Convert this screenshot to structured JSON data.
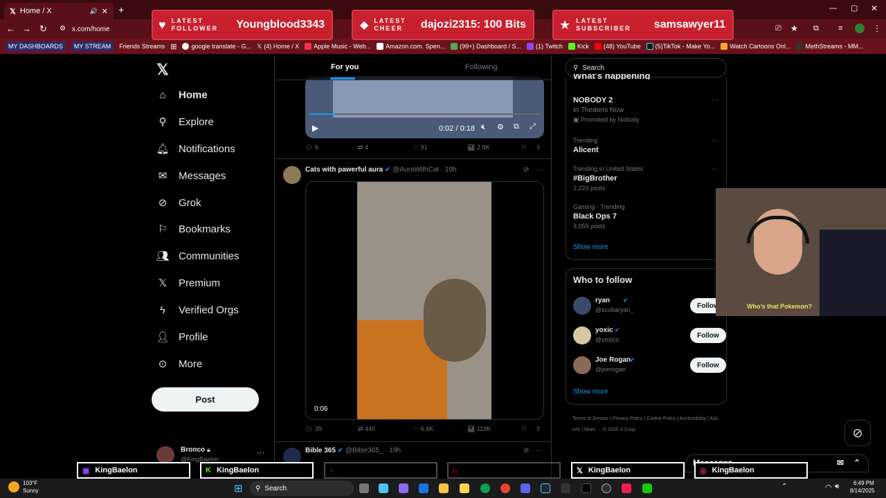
{
  "browser": {
    "tab_title": "Home / X",
    "url": "x.com/home",
    "bookmarks": [
      "MY DASHBOARDS",
      "MY STREAM",
      "Friends Streams",
      "google translate - G...",
      "(4) Home / X",
      "Apple Music - Web...",
      "Amazon.com. Spen...",
      "(99+) Dashboard / S...",
      "(1) Twitch",
      "Kick",
      "(48) YouTube",
      "(5)TikTok - Make Yo...",
      "Watch Cartoons Onl...",
      "MethStreams - MM..."
    ]
  },
  "overlay": {
    "follower_label_1": "LATEST",
    "follower_label_2": "FOLLOWER",
    "follower_value": "Youngblood3343",
    "cheer_label_1": "LATEST",
    "cheer_label_2": "CHEER",
    "cheer_value": "dajozi2315: 100 Bits",
    "sub_label_1": "LATEST",
    "sub_label_2": "SUBSCRIBER",
    "sub_value": "samsawyer11",
    "webcam_caption": "Who's that Pokemon?"
  },
  "nav": {
    "items": [
      "Home",
      "Explore",
      "Notifications",
      "Messages",
      "Grok",
      "Bookmarks",
      "Communities",
      "Premium",
      "Verified Orgs",
      "Profile",
      "More"
    ],
    "post_label": "Post",
    "account_name": "Bronco",
    "account_handle": "@KingBaelon"
  },
  "feed": {
    "tab_for_you": "For you",
    "tab_following": "Following",
    "video1": {
      "time": "0:02 / 0:18",
      "replies": "6",
      "reposts": "4",
      "likes": "91",
      "views": "2.8K"
    },
    "post2": {
      "name": "Cats with pawerful aura",
      "handle": "@AuraWithCat",
      "age": "· 19h",
      "video_time": "0:06",
      "replies": "39",
      "reposts": "440",
      "likes": "6.4K",
      "views": "119K"
    },
    "post3": {
      "name": "Bible 365",
      "handle": "@Bible365_",
      "age": "· 19h"
    }
  },
  "sidebar": {
    "search_placeholder": "Search",
    "whats_happening": "What's happening",
    "trends": [
      {
        "title": "NOBODY 2",
        "sub": "In Theaters Now",
        "meta": "Promoted by Nobody"
      },
      {
        "meta": "Trending",
        "title": "Alicent"
      },
      {
        "meta": "Trending in United States",
        "title": "#BigBrother",
        "sub": "2,224 posts"
      },
      {
        "meta": "Gaming · Trending",
        "title": "Black Ops 7",
        "sub": "3,059 posts"
      }
    ],
    "show_more": "Show more",
    "who_to_follow": "Who to follow",
    "follow_label": "Follow",
    "accounts": [
      {
        "name": "ryan",
        "handle": "@scubaryan_"
      },
      {
        "name": "yoxic",
        "handle": "@yoxics"
      },
      {
        "name": "Joe Rogan",
        "handle": "@joerogan"
      }
    ],
    "show_more_2": "Show more",
    "footer": [
      "Terms of Service",
      "Privacy Policy",
      "Cookie Policy",
      "Accessibility",
      "Ads info",
      "More ···",
      "© 2025 X Corp."
    ],
    "messages_label": "Messages"
  },
  "stream_bar": {
    "twitch": "KingBaelon",
    "kick": "KingBaelon",
    "x": "KingBaelon",
    "instagram": "KingBaelon"
  },
  "taskbar": {
    "weather_temp": "103°F",
    "weather_cond": "Sunny",
    "search": "Search",
    "time": "6:49 PM",
    "date": "8/14/2025"
  }
}
